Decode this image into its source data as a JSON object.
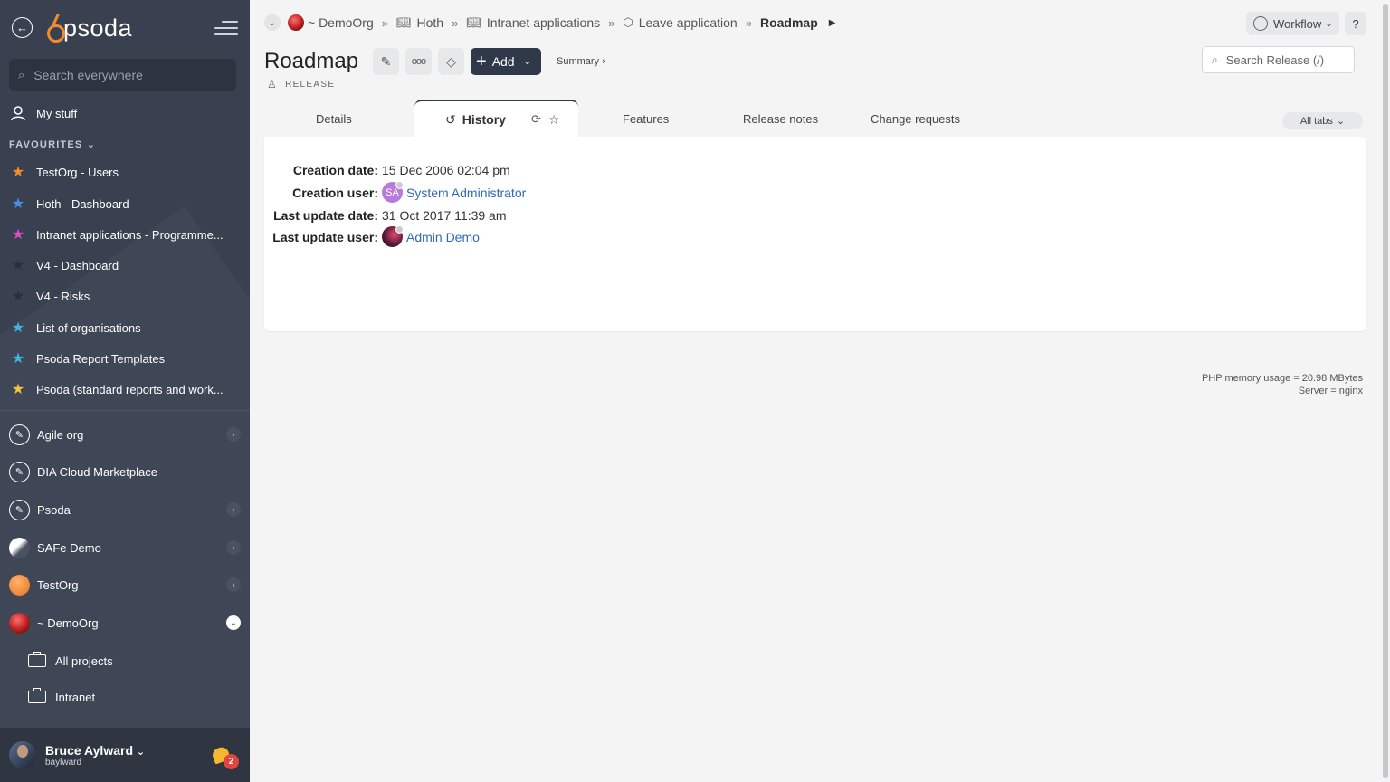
{
  "sidebar": {
    "logo_text": "psoda",
    "search_placeholder": "Search everywhere",
    "my_stuff": "My stuff",
    "favourites_label": "FAVOURITES",
    "favourites": [
      {
        "label": "TestOrg - Users",
        "color": "#f28a2e"
      },
      {
        "label": "Hoth - Dashboard",
        "color": "#4a90e2"
      },
      {
        "label": "Intranet applications - Programme...",
        "color": "#d94bc7"
      },
      {
        "label": "V4 - Dashboard",
        "color": "#2b2f38"
      },
      {
        "label": "V4 - Risks",
        "color": "#2b2f38"
      },
      {
        "label": "List of organisations",
        "color": "#3fb5e0"
      },
      {
        "label": "Psoda Report Templates",
        "color": "#3fb5e0"
      },
      {
        "label": "Psoda (standard reports and work...",
        "color": "#f5c542"
      }
    ],
    "orgs": [
      {
        "label": "Agile org"
      },
      {
        "label": "DIA Cloud Marketplace"
      },
      {
        "label": "Psoda"
      },
      {
        "label": "SAFe Demo"
      },
      {
        "label": "TestOrg"
      },
      {
        "label": "~ DemoOrg"
      }
    ],
    "sub_items": [
      {
        "label": "All projects"
      },
      {
        "label": "Intranet"
      }
    ],
    "user": {
      "name": "Bruce Aylward",
      "login": "baylward",
      "notifications": "2"
    }
  },
  "breadcrumbs": [
    {
      "label": "~ DemoOrg"
    },
    {
      "label": "Hoth"
    },
    {
      "label": "Intranet applications"
    },
    {
      "label": "Leave application"
    },
    {
      "label": "Roadmap"
    }
  ],
  "header": {
    "title": "Roadmap",
    "subtype": "RELEASE",
    "add_label": "Add",
    "summary_label": "Summary ›",
    "workflow_label": "Workflow",
    "help_label": "?",
    "search_placeholder": "Search Release (/)"
  },
  "tabs": {
    "details": "Details",
    "history": "History",
    "features": "Features",
    "release_notes": "Release notes",
    "change_requests": "Change requests",
    "all_tabs": "All tabs"
  },
  "history": {
    "creation_date_label": "Creation date:",
    "creation_date": "15 Dec 2006 02:04 pm",
    "creation_user_label": "Creation user:",
    "creation_user_initials": "SA",
    "creation_user": "System Administrator",
    "last_update_date_label": "Last update date:",
    "last_update_date": "31 Oct 2017 11:39 am",
    "last_update_user_label": "Last update user:",
    "last_update_user": "Admin Demo"
  },
  "footer": {
    "memory": "PHP memory usage = 20.98 MBytes",
    "server": "Server = nginx"
  },
  "colors": {
    "sidebar_bg": "#39404f",
    "accent_dark": "#30394a",
    "link": "#2f6bb3",
    "brand_orange": "#f28a2e"
  }
}
